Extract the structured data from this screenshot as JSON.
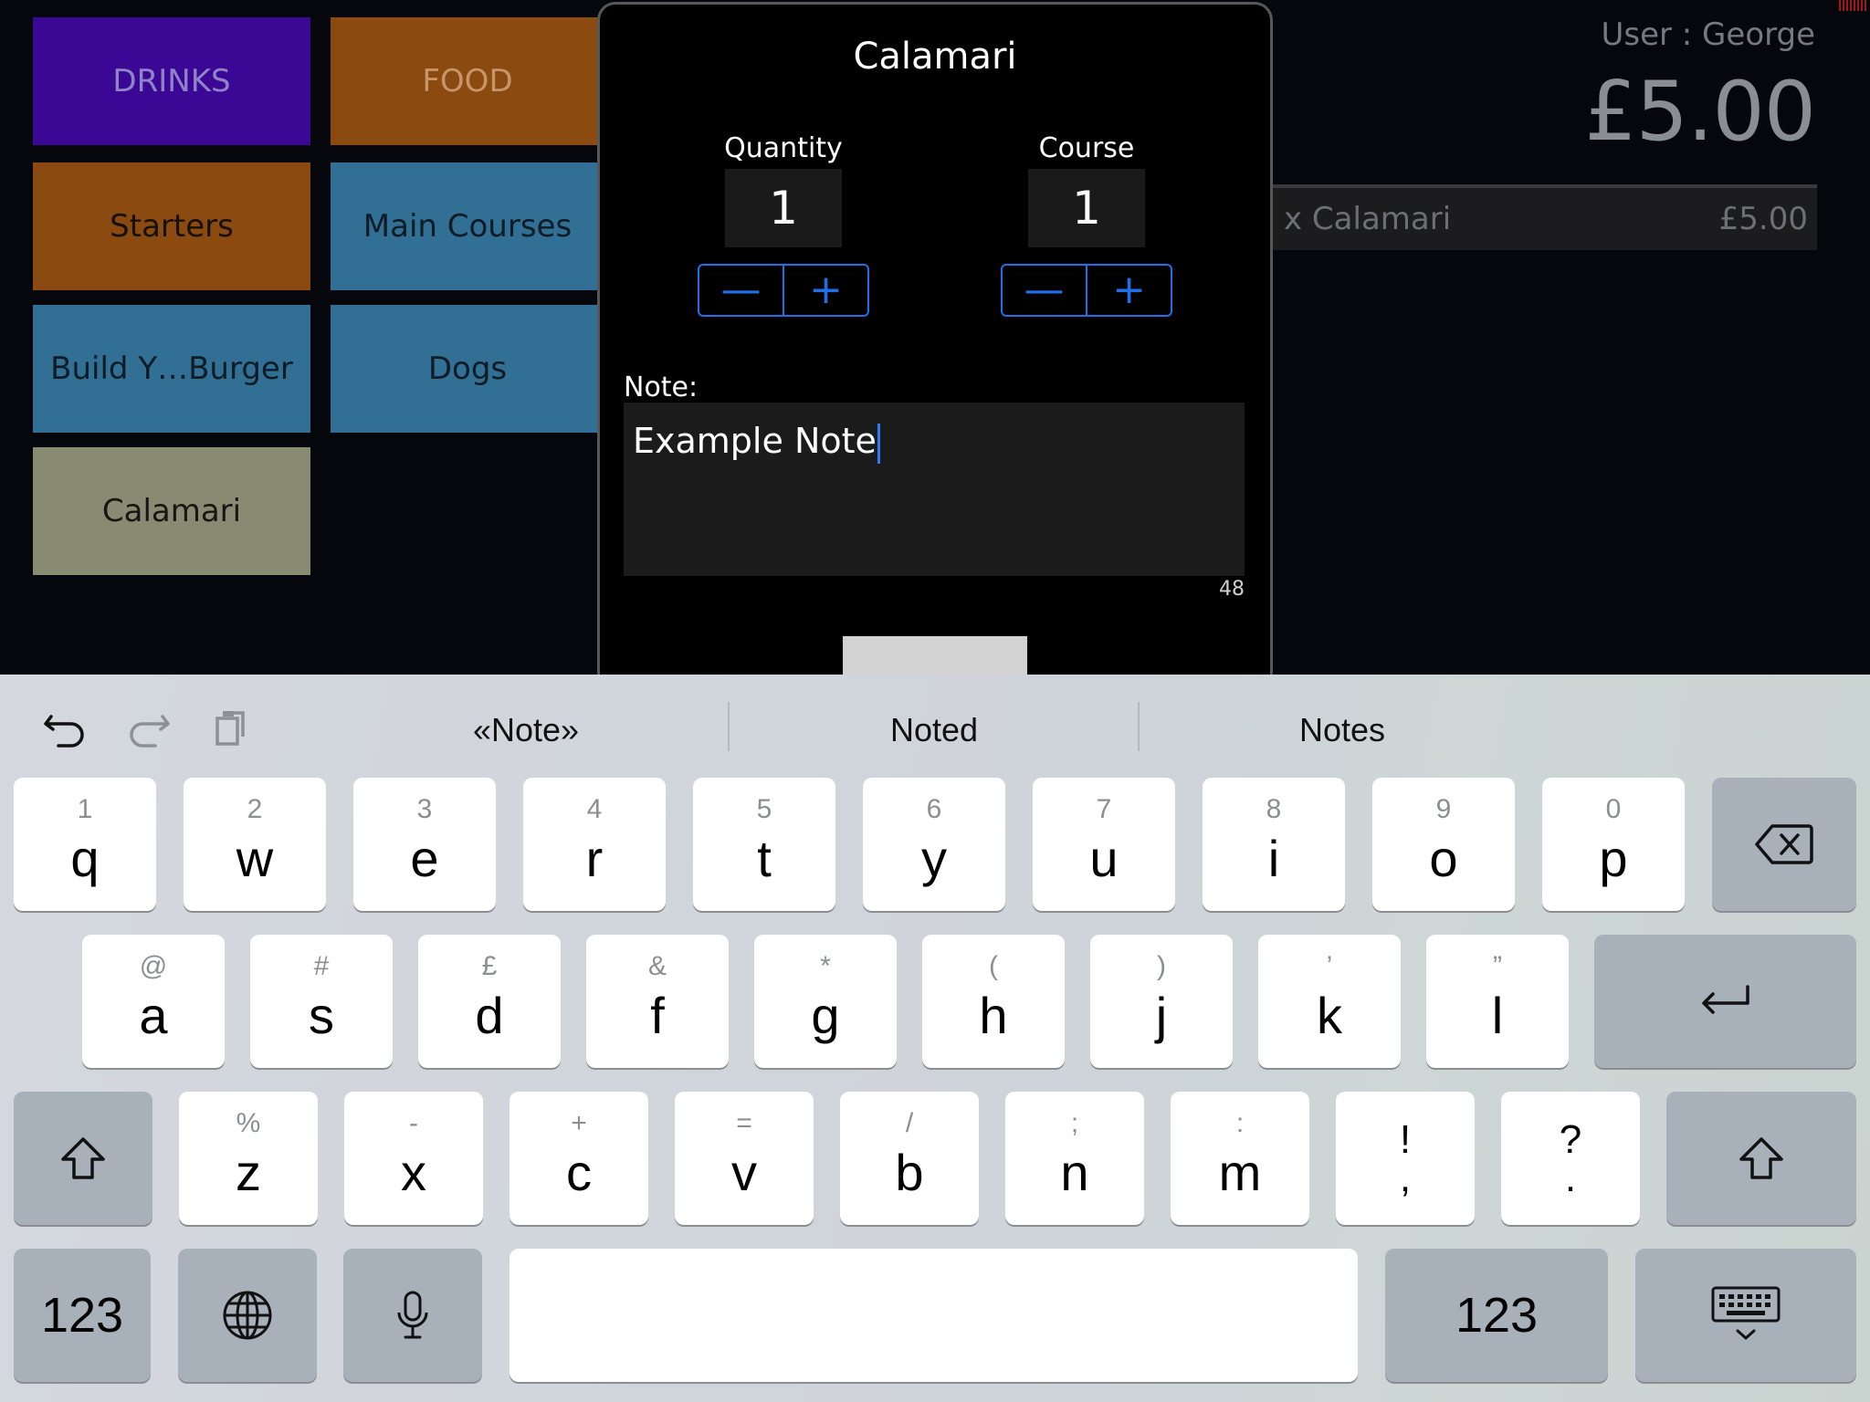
{
  "pos": {
    "tiles": [
      {
        "label": "DRINKS"
      },
      {
        "label": "FOOD"
      },
      {
        "label": "Starters"
      },
      {
        "label": "Main Courses"
      },
      {
        "label": "Build Y…Burger"
      },
      {
        "label": "Dogs"
      },
      {
        "label": "Calamari"
      }
    ],
    "user_label": "User : George",
    "total": "£5.00",
    "order_line": {
      "item": "x Calamari",
      "price": "£5.00"
    }
  },
  "modal": {
    "title": "Calamari",
    "quantity_label": "Quantity",
    "quantity_value": "1",
    "course_label": "Course",
    "course_value": "1",
    "minus": "—",
    "plus": "+",
    "note_label": "Note:",
    "note_value": "Example Note",
    "char_count": "48"
  },
  "keyboard": {
    "suggestions": [
      "«Note»",
      "Noted",
      "Notes"
    ],
    "row1": [
      {
        "sub": "1",
        "main": "q"
      },
      {
        "sub": "2",
        "main": "w"
      },
      {
        "sub": "3",
        "main": "e"
      },
      {
        "sub": "4",
        "main": "r"
      },
      {
        "sub": "5",
        "main": "t"
      },
      {
        "sub": "6",
        "main": "y"
      },
      {
        "sub": "7",
        "main": "u"
      },
      {
        "sub": "8",
        "main": "i"
      },
      {
        "sub": "9",
        "main": "o"
      },
      {
        "sub": "0",
        "main": "p"
      }
    ],
    "row2": [
      {
        "sub": "@",
        "main": "a"
      },
      {
        "sub": "#",
        "main": "s"
      },
      {
        "sub": "£",
        "main": "d"
      },
      {
        "sub": "&",
        "main": "f"
      },
      {
        "sub": "*",
        "main": "g"
      },
      {
        "sub": "(",
        "main": "h"
      },
      {
        "sub": ")",
        "main": "j"
      },
      {
        "sub": "’",
        "main": "k"
      },
      {
        "sub": "”",
        "main": "l"
      }
    ],
    "row3": [
      {
        "sub": "%",
        "main": "z"
      },
      {
        "sub": "-",
        "main": "x"
      },
      {
        "sub": "+",
        "main": "c"
      },
      {
        "sub": "=",
        "main": "v"
      },
      {
        "sub": "/",
        "main": "b"
      },
      {
        "sub": ";",
        "main": "n"
      },
      {
        "sub": ":",
        "main": "m"
      }
    ],
    "punct": [
      {
        "top": "!",
        "bottom": ","
      },
      {
        "top": "?",
        "bottom": "."
      }
    ],
    "numbers_label": "123",
    "icons": [
      "undo-icon",
      "redo-icon",
      "clipboard-icon",
      "backspace-icon",
      "return-icon",
      "shift-icon",
      "globe-icon",
      "microphone-icon",
      "keyboard-dismiss-icon"
    ]
  }
}
